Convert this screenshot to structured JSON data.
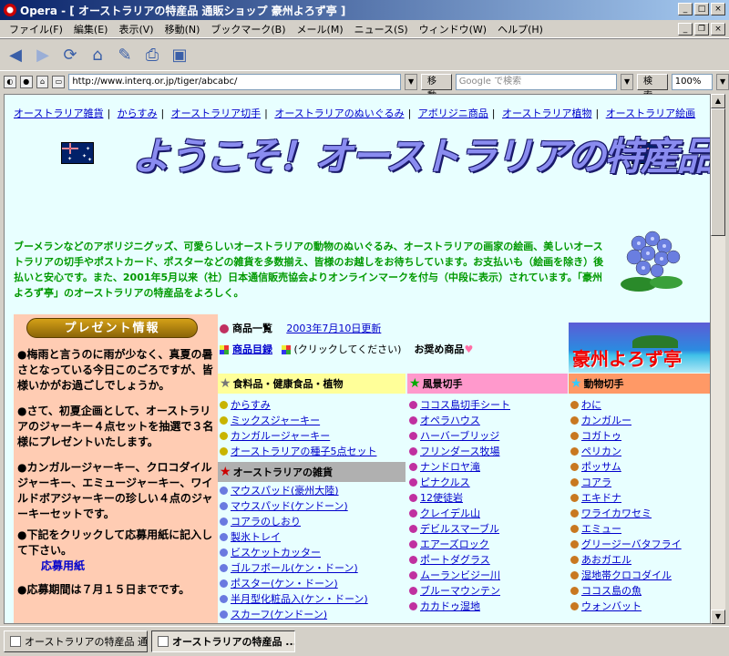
{
  "window": {
    "title": "Opera - [ オーストラリアの特産品 通販ショップ 豪州よろず亭 ]"
  },
  "menu": [
    "ファイル(F)",
    "編集(E)",
    "表示(V)",
    "移動(N)",
    "ブックマーク(B)",
    "メール(M)",
    "ニュース(S)",
    "ウィンドウ(W)",
    "ヘルプ(H)"
  ],
  "address": {
    "url": "http://www.interq.or.jp/tiger/abcabc/",
    "go_label": "移動",
    "search_placeholder": "Google で検索",
    "search_label": "検索",
    "zoom": "100%"
  },
  "page": {
    "navlinks": [
      "オーストラリア雑貨",
      "からすみ",
      "オーストラリア切手",
      "オーストラリアのぬいぐるみ",
      "アボリジニ商品",
      "オーストラリア植物",
      "オーストラリア絵画"
    ],
    "banner": "ようこそ！オーストラリアの特産品へ",
    "intro": "ブーメランなどのアボリジニグッズ、可愛らしいオーストラリアの動物のぬいぐるみ、オーストラリアの画家の絵画、美しいオーストラリアの切手やポストカード、ポスターなどの雑貨を多数揃え、皆様のお越しをお待ちしています。お支払いも（絵画を除き）後払いと安心です。また、2001年5月以来（社）日本通信販売協会よりオンラインマークを付与（中段に表示）されています。「豪州よろず亭」のオーストラリアの特産品をよろしく。",
    "present_title": "プレゼント情報",
    "present_paragraphs": [
      "●梅雨と言うのに雨が少なく、真夏の暑さとなっている今日このごろですが、皆様いかがお過ごしでしょうか。",
      "●さて、初夏企画として、オーストラリアのジャーキー４点セットを抽選で３名様にプレゼントいたします。",
      "●カンガルージャーキー、クロコダイルジャーキー、エミュージャーキー、ワイルドボアジャーキーの珍しい４点のジャーキーセットです。",
      "●下記をクリックして応募用紙に記入して下さい。",
      "●応募期間は７月１５日までです。"
    ],
    "apply_link": "応募用紙",
    "product_list_label": "商品一覧",
    "updated": "2003年7月10日更新",
    "catalog": "商品目録",
    "click_hint": "(クリックしてください)",
    "recommend": "お奨め商品",
    "shop_name": "豪州よろず亭",
    "col_food": {
      "title": "食料品・健康食品・植物",
      "items": [
        "からすみ",
        "ミックスジャーキー",
        "カンガルージャーキー",
        "オーストラリアの種子5点セット"
      ]
    },
    "col_goods": {
      "title": "オーストラリアの雑貨",
      "items": [
        "マウスパッド(豪州大陸)",
        "マウスパッド(ケンドーン)",
        "コアラのしおり",
        "製氷トレイ",
        "ビスケットカッター",
        "ゴルフボール(ケン・ドーン)",
        "ポスター(ケン・ドーン)",
        "半月型化粧品入(ケン・ドーン)",
        "スカーフ(ケンドーン)"
      ]
    },
    "col_scenery": {
      "title": "風景切手",
      "items": [
        "ココス島切手シート",
        "オペラハウス",
        "ハーバーブリッジ",
        "フリンダース牧場",
        "ナンドロヤ滝",
        "ピナクルス",
        "12使徒岩",
        "クレイデル山",
        "デビルスマーブル",
        "エアーズロック",
        "ポートダグラス",
        "ムーランビジー川",
        "ブルーマウンテン",
        "カカドゥ湿地"
      ]
    },
    "col_animal": {
      "title": "動物切手",
      "items": [
        "わに",
        "カンガルー",
        "コガトゥ",
        "ペリカン",
        "ポッサム",
        "コアラ",
        "エキドナ",
        "ワライカワセミ",
        "エミュー",
        "グリージーバタフライ",
        "あおガエル",
        "湿地帯クロコダイル",
        "ココス島の魚",
        "ウォンバット"
      ]
    }
  },
  "taskbar": [
    "オーストラリアの特産品 通...",
    "オーストラリアの特産品 ..."
  ],
  "colors": {
    "food_head": "#ffff99",
    "scenery_head": "#ff99cc",
    "animal_head": "#ff9966",
    "goods_head": "#b0b0b0",
    "link": "#0000cc",
    "intro_text": "#009900"
  }
}
